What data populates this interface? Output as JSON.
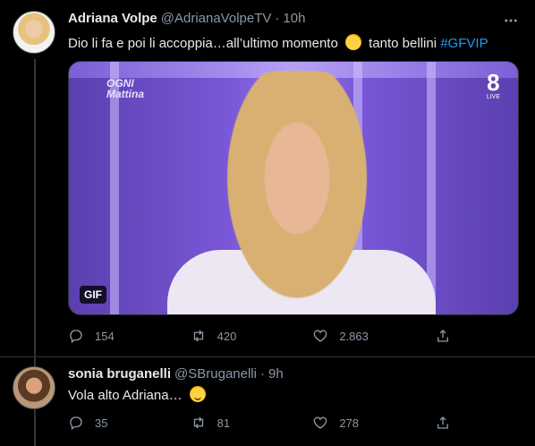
{
  "tweets": [
    {
      "author": {
        "name": "Adriana Volpe",
        "handle": "@AdrianaVolpeTV",
        "time": "10h"
      },
      "text": {
        "part1": "Dio li fa e poi li accoppia…all’ultimo momento",
        "emoji": "rolling-on-floor-laughing",
        "part2": "tanto bellini",
        "hashtag": "#GFVIP"
      },
      "media": {
        "badge": "GIF",
        "show_logo_line1": "OGNI",
        "show_logo_line2": "Mattina",
        "channel_logo": "8",
        "channel_logo_sub": "LIVE"
      },
      "stats": {
        "replies": "154",
        "retweets": "420",
        "likes": "2.863"
      }
    },
    {
      "author": {
        "name": "sonia bruganelli",
        "handle": "@SBruganelli",
        "time": "9h"
      },
      "text": {
        "part1": "Vola alto Adriana…",
        "emoji": "winking-face"
      },
      "stats": {
        "replies": "35",
        "retweets": "81",
        "likes": "278"
      }
    }
  ],
  "icons": {
    "reply": "reply-icon",
    "retweet": "retweet-icon",
    "like": "heart-icon",
    "share": "share-icon",
    "more": "more-icon"
  },
  "colors": {
    "background": "#000000",
    "text": "#e7e9ea",
    "muted": "#8b98a5",
    "link": "#1d9bf0",
    "border": "#2f3336"
  }
}
